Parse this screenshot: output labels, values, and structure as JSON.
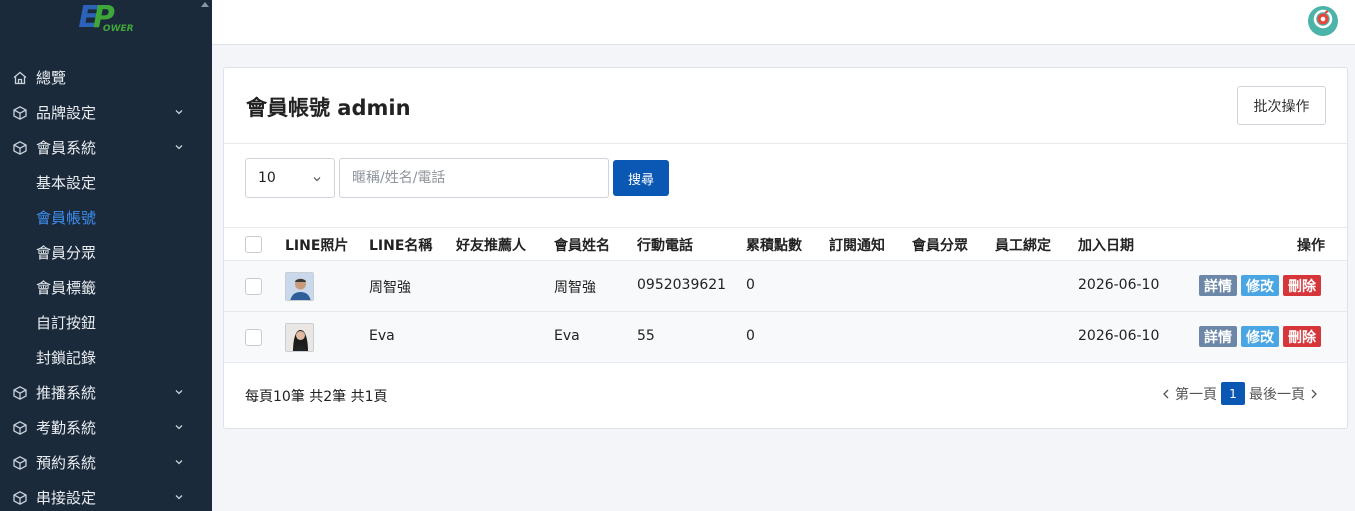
{
  "logo": {
    "e": "E",
    "p": "P",
    "sub": "OWER"
  },
  "sidebar": {
    "items": [
      {
        "label": "總覽",
        "icon": "home-icon",
        "expandable": false
      },
      {
        "label": "品牌設定",
        "icon": "cube-icon",
        "expandable": true
      },
      {
        "label": "會員系統",
        "icon": "cube-icon",
        "expandable": true
      }
    ],
    "subitems": [
      {
        "label": "基本設定"
      },
      {
        "label": "會員帳號",
        "active": true
      },
      {
        "label": "會員分眾"
      },
      {
        "label": "會員標籤"
      },
      {
        "label": "自訂按鈕"
      },
      {
        "label": "封鎖記錄"
      }
    ],
    "items2": [
      {
        "label": "推播系統",
        "icon": "cube-icon"
      },
      {
        "label": "考勤系統",
        "icon": "cube-icon"
      },
      {
        "label": "預約系統",
        "icon": "cube-icon"
      },
      {
        "label": "串接設定",
        "icon": "cube-icon"
      }
    ],
    "active_color": "#3d8ef0"
  },
  "header": {
    "title": "會員帳號 admin",
    "batch_label": "批次操作"
  },
  "filters": {
    "page_size": "10",
    "search_placeholder": "暱稱/姓名/電話",
    "search_label": "搜尋"
  },
  "table": {
    "columns": [
      "LINE照片",
      "LINE名稱",
      "好友推薦人",
      "會員姓名",
      "行動電話",
      "累積點數",
      "訂閱通知",
      "會員分眾",
      "員工綁定",
      "加入日期",
      "操作"
    ],
    "rows": [
      {
        "line_name": "周智強",
        "referrer": "",
        "name": "周智強",
        "phone": "0952039621",
        "points": "0",
        "subscribe": "",
        "segment": "",
        "staff": "",
        "joined": "2026-06-10",
        "photo": "male-avatar"
      },
      {
        "line_name": "Eva",
        "referrer": "",
        "name": "Eva",
        "phone": "55",
        "points": "0",
        "subscribe": "",
        "segment": "",
        "staff": "",
        "joined": "2026-06-10",
        "photo": "female-avatar"
      }
    ],
    "actions": {
      "detail": "詳情",
      "edit": "修改",
      "delete": "刪除"
    }
  },
  "footer": {
    "summary": "每頁10筆 共2筆 共1頁"
  },
  "pager": {
    "first": "第一頁",
    "current": "1",
    "last": "最後一頁"
  },
  "colors": {
    "sidebar_bg": "#1b2a3a",
    "primary": "#0b57b4",
    "detail": "#6c87a8",
    "edit": "#4aa6e2",
    "delete": "#d6363a"
  }
}
